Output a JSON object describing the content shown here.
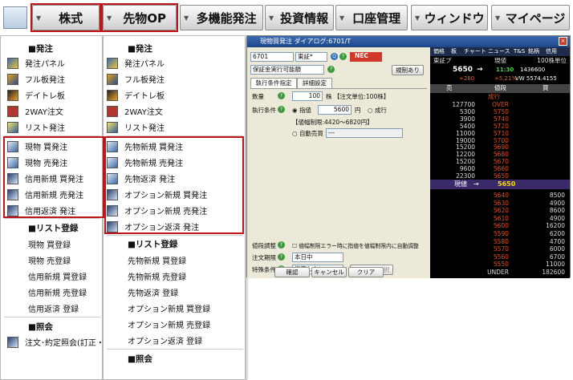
{
  "menubar": {
    "tabs": [
      {
        "label": "株式"
      },
      {
        "label": "先物OP"
      },
      {
        "label": "多機能発注"
      },
      {
        "label": "投資情報"
      },
      {
        "label": "口座管理"
      },
      {
        "label": "ウィンドウ"
      },
      {
        "label": "マイページ"
      }
    ]
  },
  "stock_menu": {
    "order_header": "■発注",
    "order_items": [
      {
        "label": "発注パネル",
        "icon": "order-panel-icon"
      },
      {
        "label": "フル板発注",
        "icon": "full-board-icon"
      },
      {
        "label": "デイトレ板",
        "icon": "daytrade-icon"
      },
      {
        "label": "2WAY注文",
        "icon": "twoway-icon"
      },
      {
        "label": "リスト発注",
        "icon": "list-order-icon"
      }
    ],
    "highlighted_items": [
      {
        "label": "現物 買発注",
        "icon": "spot-buy-icon"
      },
      {
        "label": "現物 売発注",
        "icon": "spot-sell-icon"
      },
      {
        "label": "信用新規 買発注",
        "icon": "margin-buy-icon"
      },
      {
        "label": "信用新規 売発注",
        "icon": "margin-sell-icon"
      },
      {
        "label": "信用返済 発注",
        "icon": "margin-repay-icon"
      }
    ],
    "list_header": "■リスト登録",
    "list_items": [
      "現物 買登録",
      "現物 売登録",
      "信用新規 買登録",
      "信用新規 売登録",
      "信用返済 登録"
    ],
    "inquiry_header": "■照会",
    "inquiry_items": [
      {
        "label": "注文･約定照会(訂正・取",
        "icon": "inquiry-icon"
      }
    ]
  },
  "futures_menu": {
    "order_header": "■発注",
    "order_items": [
      {
        "label": "発注パネル"
      },
      {
        "label": "フル板発注"
      },
      {
        "label": "デイトレ板"
      },
      {
        "label": "2WAY注文"
      },
      {
        "label": "リスト発注"
      }
    ],
    "highlighted_items": [
      {
        "label": "先物新規 買発注"
      },
      {
        "label": "先物新規 売発注"
      },
      {
        "label": "先物返済 発注"
      },
      {
        "label": "オプション新規 買発注"
      },
      {
        "label": "オプション新規 売発注"
      },
      {
        "label": "オプション返済 発注"
      }
    ],
    "list_header": "■リスト登録",
    "list_items": [
      "先物新規 買登録",
      "先物新規 売登録",
      "先物返済 登録",
      "オプション新規 買登録",
      "オプション新規 売登録",
      "オプション返済 登録"
    ],
    "inquiry_header": "■照会"
  },
  "order_window": {
    "title": "現物買発注 ダイアログ:6701/T",
    "close": "×",
    "code": "6701",
    "market": "東証*",
    "symbol_name": "NEC",
    "account": "保証金実行可能額",
    "history_button": "規制あり",
    "tabs": [
      "執行条件指定",
      "詳細設定"
    ],
    "qty_label": "数量",
    "qty_value": "100",
    "qty_unit": "株 【注文単位:100株】",
    "exec_label": "執行条件",
    "limit_label": "指値",
    "price_value": "5600",
    "yen": "円",
    "market_order": "成行",
    "price_range": "【値幅制限:4420〜6820円】",
    "auto_label": "自動売買",
    "auto_value": "---",
    "adjust_label": "値段調整",
    "adjust_text": "値幅制限エラー時に指値を値幅制限内に自動調整",
    "period_label": "注文期限",
    "period_value": "本日中",
    "special_label": "特殊条件",
    "special_value": "指定しない",
    "relay_button": "リレー先選択",
    "confirm": "確認",
    "cancel": "キャンセル",
    "clear": "クリア"
  },
  "board": {
    "tabs": [
      "価格",
      "板",
      "チャート",
      "ニュース",
      "T&S",
      "銘柄",
      "信用"
    ],
    "exchange": "東証プ",
    "current_label": "現値",
    "lot_label": "100株単位",
    "price": "5650",
    "arrow": "→",
    "time": "11:30",
    "change": "+280",
    "change_pct": "+5.21%",
    "vwap": "VW 5574.4155",
    "volume": "1436600",
    "headers": [
      "売",
      "値段",
      "買"
    ],
    "market_label": "成行",
    "asks": [
      {
        "qty": "OVER",
        "price": ""
      },
      {
        "qty": "127700",
        "price": "OVER"
      },
      {
        "qty": "5300",
        "price": "5750"
      },
      {
        "qty": "3900",
        "price": "5740"
      },
      {
        "qty": "5400",
        "price": "5720"
      },
      {
        "qty": "11000",
        "price": "5710"
      },
      {
        "qty": "19000",
        "price": "5700"
      },
      {
        "qty": "15200",
        "price": "5690"
      },
      {
        "qty": "12200",
        "price": "5680"
      },
      {
        "qty": "15200",
        "price": "5670"
      },
      {
        "qty": "9600",
        "price": "5660"
      },
      {
        "qty": "22300",
        "price": "5650"
      }
    ],
    "current_row": {
      "label": "現値",
      "price": "5650"
    },
    "bids": [
      {
        "price": "5640",
        "qty": "8500"
      },
      {
        "price": "5630",
        "qty": "4900"
      },
      {
        "price": "5620",
        "qty": "8600"
      },
      {
        "price": "5610",
        "qty": "4900"
      },
      {
        "price": "5600",
        "qty": "16200"
      },
      {
        "price": "5590",
        "qty": "6200"
      },
      {
        "price": "5580",
        "qty": "4700"
      },
      {
        "price": "5570",
        "qty": "6000"
      },
      {
        "price": "5560",
        "qty": "6700"
      },
      {
        "price": "5550",
        "qty": "11000"
      },
      {
        "price": "UNDER",
        "qty": "182600"
      }
    ],
    "colors": {
      "ask": "#e05020",
      "bid": "#e05020",
      "accent_red": "#c0141b"
    }
  }
}
